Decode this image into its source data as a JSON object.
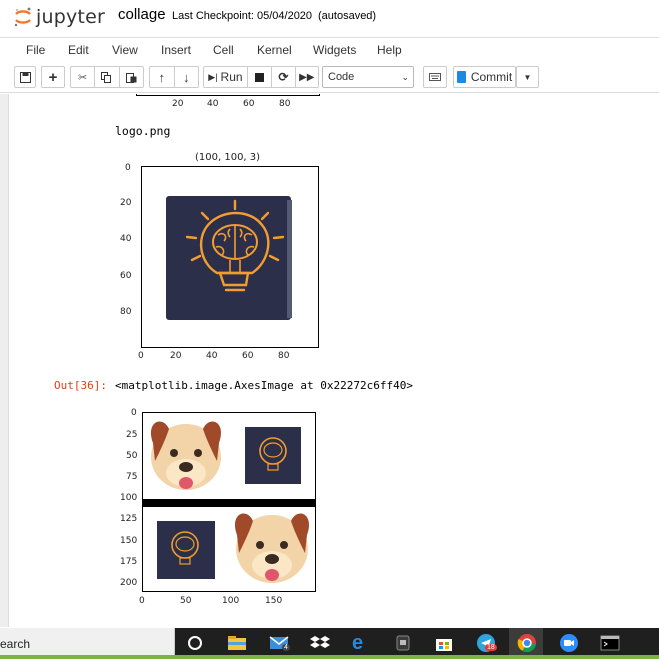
{
  "header": {
    "logo_text": "jupyter",
    "notebook_name": "collage",
    "checkpoint": "Last Checkpoint: 05/04/2020",
    "autosaved": "(autosaved)"
  },
  "menu": [
    "File",
    "Edit",
    "View",
    "Insert",
    "Cell",
    "Kernel",
    "Widgets",
    "Help"
  ],
  "toolbar": {
    "run_label": "Run",
    "cell_type": "Code",
    "commit_label": "Commit"
  },
  "output": {
    "filename": "logo.png",
    "plot_title": "(100, 100, 3)",
    "out_prompt": "Out[36]:",
    "out_repr": "<matplotlib.image.AxesImage at 0x22272c6ff40>"
  },
  "chart_data": [
    {
      "type": "image",
      "title": "",
      "xticks": [
        "20",
        "40",
        "60",
        "80"
      ],
      "note": "partially visible axes above"
    },
    {
      "type": "image",
      "title": "(100, 100, 3)",
      "xticks": [
        "0",
        "20",
        "40",
        "60",
        "80"
      ],
      "yticks": [
        "0",
        "20",
        "40",
        "60",
        "80"
      ],
      "xlim": [
        0,
        100
      ],
      "ylim": [
        100,
        0
      ],
      "content": "brain-lightbulb-logo"
    },
    {
      "type": "image",
      "title": "",
      "xticks": [
        "0",
        "50",
        "100",
        "150"
      ],
      "yticks": [
        "0",
        "25",
        "50",
        "75",
        "100",
        "125",
        "150",
        "175",
        "200"
      ],
      "xlim": [
        0,
        200
      ],
      "ylim": [
        210,
        0
      ],
      "content": "collage of dog face and logo"
    }
  ],
  "taskbar": {
    "search_text": "earch",
    "mail_badge": "4",
    "telegram_badge": "18"
  },
  "colors": {
    "prompt": "#d84315",
    "logo_bg": "#2b2f4a",
    "logo_orange": "#f39c2f",
    "commit_blue": "#1e88e5",
    "taskbar": "#1f1f1f"
  }
}
